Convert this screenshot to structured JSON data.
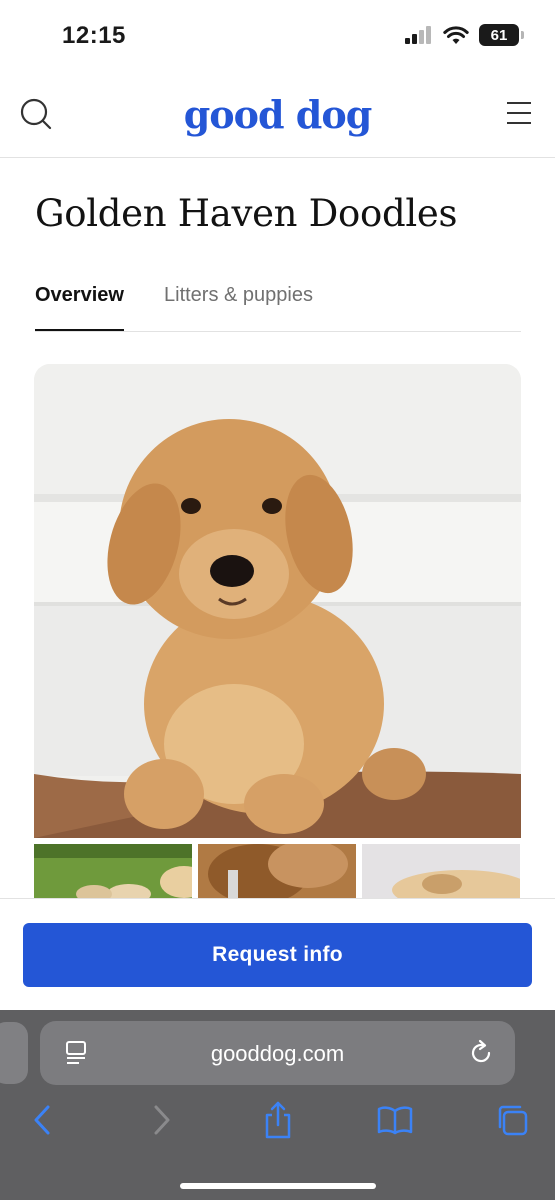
{
  "status_bar": {
    "time": "12:15",
    "battery": "61"
  },
  "header": {
    "logo": "good dog"
  },
  "page": {
    "title": "Golden Haven Doodles"
  },
  "tabs": [
    {
      "label": "Overview",
      "active": true
    },
    {
      "label": "Litters & puppies",
      "active": false
    }
  ],
  "cta": {
    "label": "Request info"
  },
  "browser": {
    "url": "gooddog.com"
  },
  "colors": {
    "brand": "#2456d6",
    "text": "#121212",
    "muted": "#707070",
    "browser_bar": "#5f5f61"
  },
  "icons": [
    "search-icon",
    "menu-icon",
    "reader-mode-icon",
    "reload-icon",
    "back-icon",
    "forward-icon",
    "share-icon",
    "bookmarks-icon",
    "tabs-icon"
  ]
}
